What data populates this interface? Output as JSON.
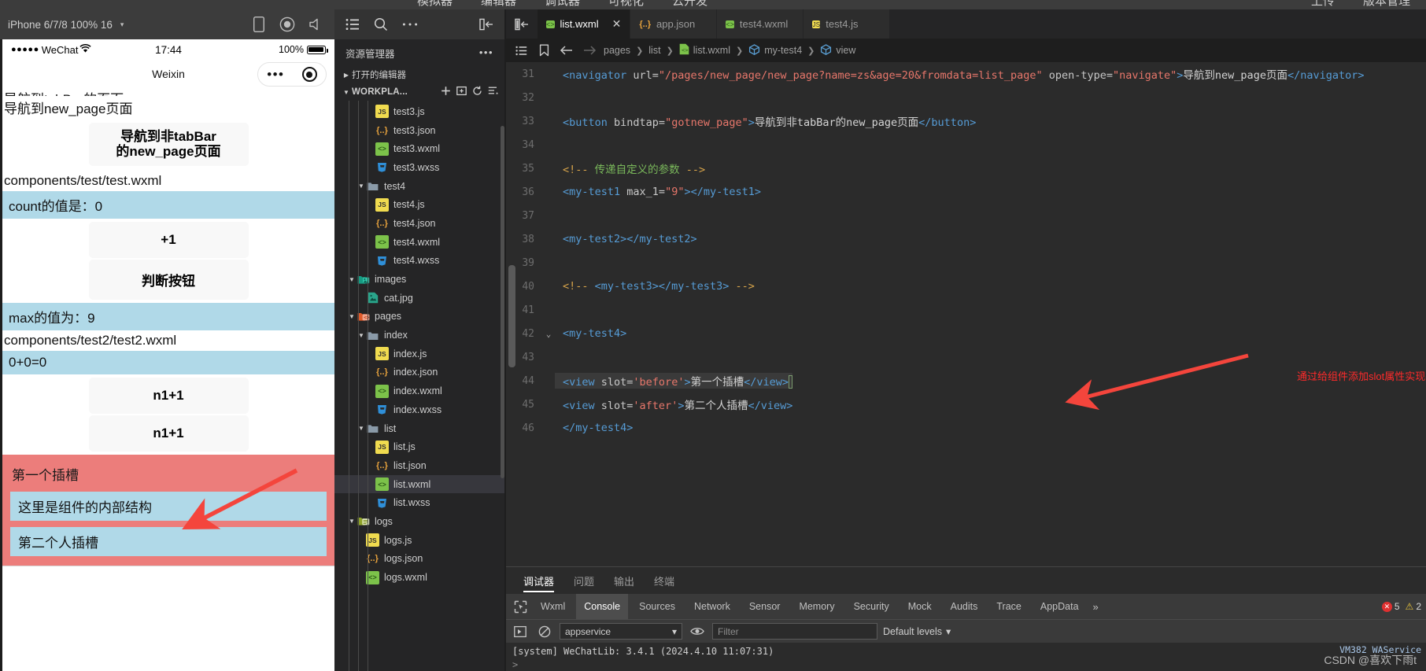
{
  "topmenu": {
    "items": [
      "模拟器",
      "编辑器",
      "调试器",
      "可视化",
      "云开发"
    ],
    "right_items": [
      "上传",
      "版本管理"
    ]
  },
  "simulator": {
    "device": "iPhone 6/7/8 100% 16",
    "caret": "▾",
    "icons": [
      "phone-icon",
      "record-icon",
      "volume-icon"
    ],
    "status": {
      "signal_dots": "●●●●●",
      "carrier": "WeChat",
      "wifi": "wifi-icon",
      "time": "17:44",
      "battery_percent": "100%"
    },
    "nav_title": "Weixin",
    "capsule": {
      "menu": "•••",
      "target": "target-icon"
    },
    "page": {
      "clipped_text": "导航到tabBar的页面",
      "nav_link_text": "导航到new_page页面",
      "button_nav": "导航到非tabBar\n的new_page页面",
      "button_nav_line1": "导航到非tabBar",
      "button_nav_line2": "的new_page页面",
      "path_test": "components/test/test.wxml",
      "count_label": "count的值是：0",
      "btn_plus1": "+1",
      "btn_judge": "判断按钮",
      "max_label": "max的值为：9",
      "path_test2": "components/test2/test2.wxml",
      "sum_label": "0+0=0",
      "btn_n1a": "n1+1",
      "btn_n1b": "n1+1",
      "slot_first": "第一个插槽",
      "slot_inner": "这里是组件的内部结构",
      "slot_second": "第二个人插槽"
    }
  },
  "explorer": {
    "toolbar_icons": [
      "list-icon",
      "search-icon",
      "more-icon",
      "collapse-panel-icon"
    ],
    "title": "资源管理器",
    "more": "•••",
    "open_editors": "打开的编辑器",
    "workspace": "WORKPLA...",
    "workspace_actions": [
      "new-file-icon",
      "new-folder-icon",
      "refresh-icon",
      "collapse-all-icon"
    ],
    "tree": [
      {
        "name": "test3.js",
        "icon": "js",
        "indent": 3,
        "type": "file"
      },
      {
        "name": "test3.json",
        "icon": "json",
        "indent": 3,
        "type": "file"
      },
      {
        "name": "test3.wxml",
        "icon": "wxml",
        "indent": 3,
        "type": "file"
      },
      {
        "name": "test3.wxss",
        "icon": "wxss",
        "indent": 3,
        "type": "file"
      },
      {
        "name": "test4",
        "icon": "folder",
        "indent": 2,
        "type": "folder",
        "open": true
      },
      {
        "name": "test4.js",
        "icon": "js",
        "indent": 3,
        "type": "file"
      },
      {
        "name": "test4.json",
        "icon": "json",
        "indent": 3,
        "type": "file"
      },
      {
        "name": "test4.wxml",
        "icon": "wxml",
        "indent": 3,
        "type": "file"
      },
      {
        "name": "test4.wxss",
        "icon": "wxss",
        "indent": 3,
        "type": "file"
      },
      {
        "name": "images",
        "icon": "folder-img",
        "indent": 1,
        "type": "folder",
        "open": true
      },
      {
        "name": "cat.jpg",
        "icon": "img",
        "indent": 2,
        "type": "file"
      },
      {
        "name": "pages",
        "icon": "folder-pages",
        "indent": 1,
        "type": "folder",
        "open": true
      },
      {
        "name": "index",
        "icon": "folder",
        "indent": 2,
        "type": "folder",
        "open": true
      },
      {
        "name": "index.js",
        "icon": "js",
        "indent": 3,
        "type": "file"
      },
      {
        "name": "index.json",
        "icon": "json",
        "indent": 3,
        "type": "file"
      },
      {
        "name": "index.wxml",
        "icon": "wxml",
        "indent": 3,
        "type": "file"
      },
      {
        "name": "index.wxss",
        "icon": "wxss",
        "indent": 3,
        "type": "file"
      },
      {
        "name": "list",
        "icon": "folder",
        "indent": 2,
        "type": "folder",
        "open": true
      },
      {
        "name": "list.js",
        "icon": "js",
        "indent": 3,
        "type": "file"
      },
      {
        "name": "list.json",
        "icon": "json",
        "indent": 3,
        "type": "file"
      },
      {
        "name": "list.wxml",
        "icon": "wxml",
        "indent": 3,
        "type": "file",
        "selected": true
      },
      {
        "name": "list.wxss",
        "icon": "wxss",
        "indent": 3,
        "type": "file"
      },
      {
        "name": "logs",
        "icon": "folder-logs",
        "indent": 1,
        "type": "folder",
        "open": true
      },
      {
        "name": "logs.js",
        "icon": "js",
        "indent": 2,
        "type": "file"
      },
      {
        "name": "logs.json",
        "icon": "json",
        "indent": 2,
        "type": "file"
      },
      {
        "name": "logs.wxml",
        "icon": "wxml",
        "indent": 2,
        "type": "file"
      }
    ]
  },
  "editor": {
    "tabs": [
      {
        "label": "list.wxml",
        "icon": "wxml",
        "active": true,
        "close": "✕"
      },
      {
        "label": "app.json",
        "icon": "json",
        "active": false
      },
      {
        "label": "test4.wxml",
        "icon": "wxml",
        "active": false
      },
      {
        "label": "test4.js",
        "icon": "js",
        "active": false
      }
    ],
    "breadcrumb": [
      "pages",
      "list",
      "list.wxml",
      "my-test4",
      "view"
    ],
    "breadcrumb_icons": [
      "outline-icon",
      "bookmark-icon",
      "back-arrow-icon",
      "forward-arrow-icon"
    ],
    "annotation": "通过给组件添加slot属性实现插槽的绑定",
    "lines": [
      {
        "n": 31,
        "tokens": [
          {
            "t": "tag",
            "v": "<navigator "
          },
          {
            "t": "attr",
            "v": "url="
          },
          {
            "t": "str",
            "v": "\"/pages/new_page/new_page?name=zs&age=20&fromdata=list_page\""
          },
          {
            "t": "attr",
            "v": " open-type="
          },
          {
            "t": "str",
            "v": "\"navigate\""
          },
          {
            "t": "tag",
            "v": ">"
          },
          {
            "t": "txt",
            "v": "导航到new_page页面"
          },
          {
            "t": "tag",
            "v": "</navigator>"
          }
        ]
      },
      {
        "n": 32,
        "tokens": []
      },
      {
        "n": 33,
        "tokens": [
          {
            "t": "tag",
            "v": "<button "
          },
          {
            "t": "attr",
            "v": "bindtap="
          },
          {
            "t": "str",
            "v": "\"gotnew_page\""
          },
          {
            "t": "tag",
            "v": ">"
          },
          {
            "t": "txt",
            "v": "导航到非tabBar的new_page页面"
          },
          {
            "t": "tag",
            "v": "</button>"
          }
        ]
      },
      {
        "n": 34,
        "tokens": []
      },
      {
        "n": 35,
        "tokens": [
          {
            "t": "cmtd",
            "v": "<!-- "
          },
          {
            "t": "cmt",
            "v": "传递自定义的参数"
          },
          {
            "t": "cmtd",
            "v": " -->"
          }
        ]
      },
      {
        "n": 36,
        "tokens": [
          {
            "t": "tag",
            "v": "<my-test1 "
          },
          {
            "t": "attr",
            "v": "max_1="
          },
          {
            "t": "str",
            "v": "\"9\""
          },
          {
            "t": "tag",
            "v": "></my-test1>"
          }
        ]
      },
      {
        "n": 37,
        "tokens": []
      },
      {
        "n": 38,
        "tokens": [
          {
            "t": "tag",
            "v": "<my-test2></my-test2>"
          }
        ]
      },
      {
        "n": 39,
        "tokens": []
      },
      {
        "n": 40,
        "tokens": [
          {
            "t": "cmtd",
            "v": "<!-- "
          },
          {
            "t": "tag",
            "v": "<my-test3></my-test3>"
          },
          {
            "t": "cmtd",
            "v": " -->"
          }
        ]
      },
      {
        "n": 41,
        "tokens": []
      },
      {
        "n": 42,
        "fold": "⌄",
        "tokens": [
          {
            "t": "tag",
            "v": "<my-test4>"
          }
        ]
      },
      {
        "n": 43,
        "tokens": []
      },
      {
        "n": 44,
        "highlight": true,
        "cursor": true,
        "tokens": [
          {
            "t": "tag",
            "v": "<view "
          },
          {
            "t": "attr",
            "v": "slot="
          },
          {
            "t": "str",
            "v": "'before'"
          },
          {
            "t": "tag",
            "v": ">"
          },
          {
            "t": "txt",
            "v": "第一个插槽"
          },
          {
            "t": "tag",
            "v": "</view>"
          }
        ]
      },
      {
        "n": 45,
        "tokens": [
          {
            "t": "tag",
            "v": "<view "
          },
          {
            "t": "attr",
            "v": "slot="
          },
          {
            "t": "str",
            "v": "'after'"
          },
          {
            "t": "tag",
            "v": ">"
          },
          {
            "t": "txt",
            "v": "第二个人插槽"
          },
          {
            "t": "tag",
            "v": "</view>"
          }
        ]
      },
      {
        "n": 46,
        "tokens": [
          {
            "t": "tag",
            "v": "</my-test4>"
          }
        ]
      }
    ]
  },
  "devpanel": {
    "tabs": [
      {
        "label": "调试器",
        "active": true
      },
      {
        "label": "问题",
        "active": false
      },
      {
        "label": "输出",
        "active": false
      },
      {
        "label": "终端",
        "active": false
      }
    ],
    "toolbar": {
      "inspect_icon": "inspect-element-icon",
      "items": [
        "Wxml",
        "Console",
        "Sources",
        "Network",
        "Sensor",
        "Memory",
        "Security",
        "Mock",
        "Audits",
        "Trace",
        "AppData"
      ],
      "active": "Console",
      "overflow": "»",
      "error_count": "5",
      "warn_count": "2",
      "error_icon": "error-icon",
      "warn_icon": "warning-icon"
    },
    "console": {
      "run_icon": "run-icon",
      "clear_icon": "clear-icon",
      "context": "appservice",
      "eye_icon": "eye-icon",
      "filter_placeholder": "Filter",
      "levels": "Default levels",
      "levels_caret": "▾",
      "message": "[system] WeChatLib: 3.4.1 (2024.4.10 11:07:31)",
      "vm_label": "VM382 WAService",
      "prompt": ">"
    }
  },
  "watermark": "CSDN @喜欢下雨t"
}
